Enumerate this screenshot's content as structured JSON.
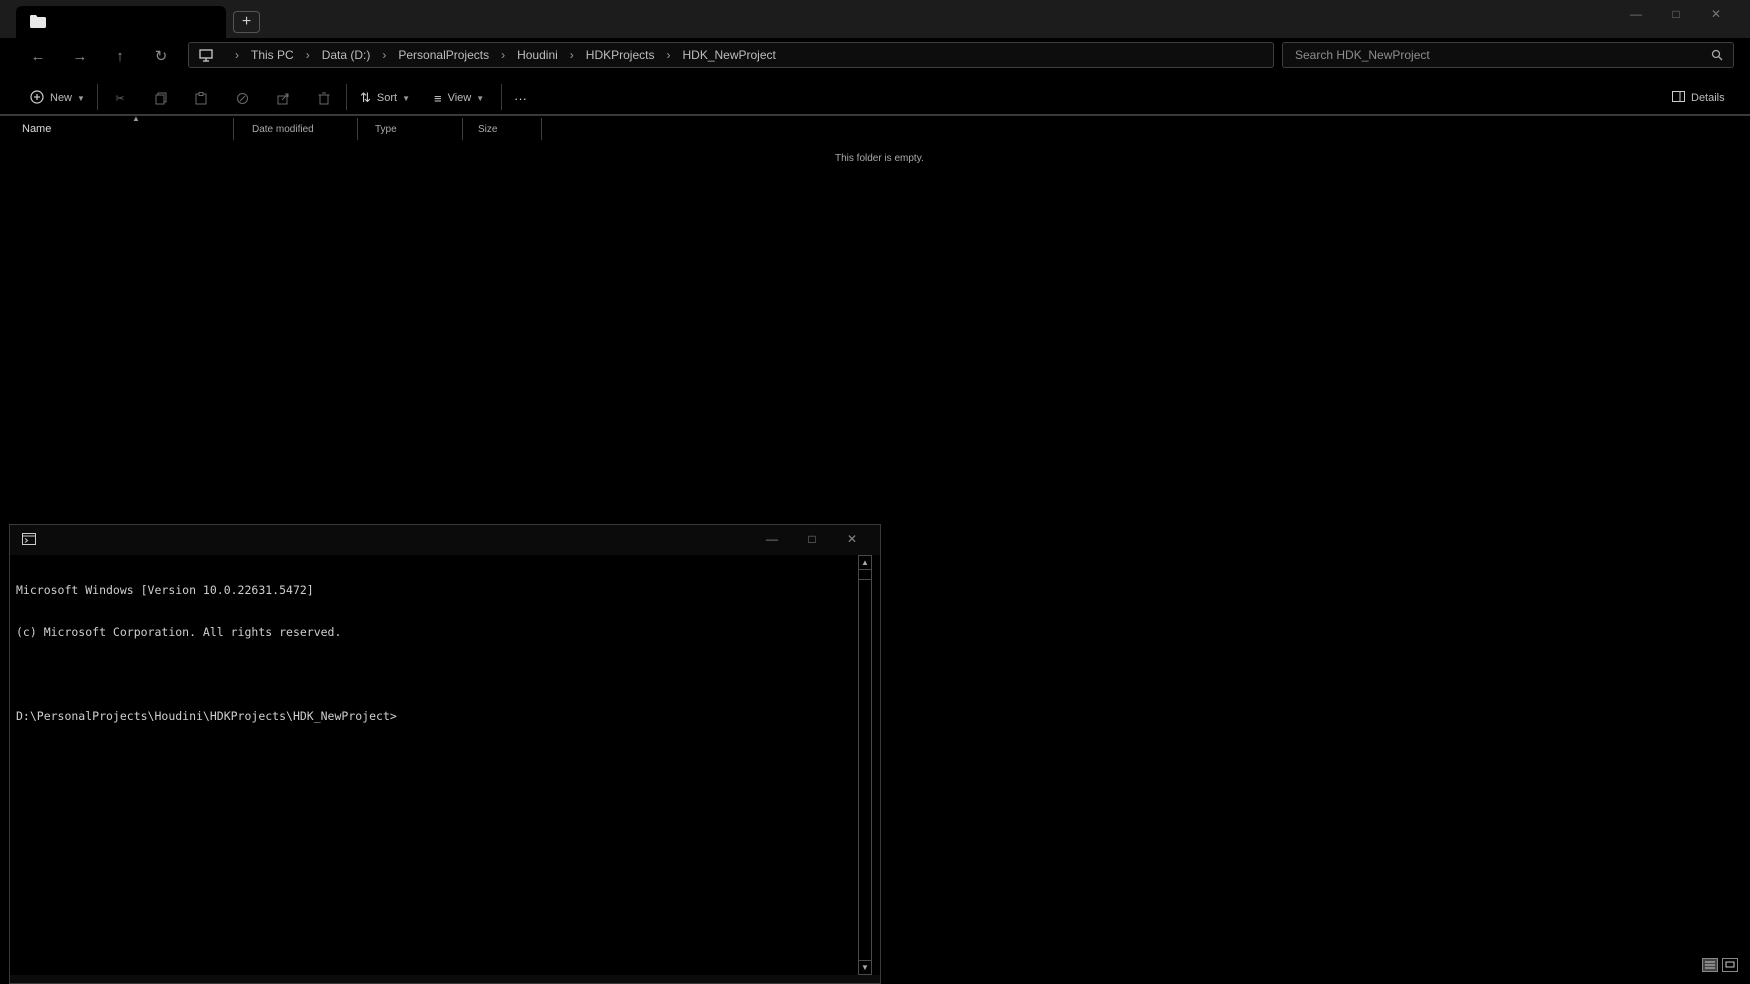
{
  "window": {
    "controls": [
      "minimize",
      "maximize",
      "close"
    ]
  },
  "tabs": {
    "new_tab_label": "+"
  },
  "address": {
    "breadcrumbs": [
      "This PC",
      "Data (D:)",
      "PersonalProjects",
      "Houdini",
      "HDKProjects",
      "HDK_NewProject"
    ]
  },
  "search": {
    "placeholder": "Search HDK_NewProject"
  },
  "commands": {
    "new_label": "New",
    "sort_label": "Sort",
    "view_label": "View",
    "more_label": "···",
    "details_label": "Details"
  },
  "columns": {
    "name": "Name",
    "date_modified": "Date modified",
    "type": "Type",
    "size": "Size"
  },
  "content": {
    "empty_message": "This folder is empty."
  },
  "console": {
    "lines": [
      "Microsoft Windows [Version 10.0.22631.5472]",
      "(c) Microsoft Corporation. All rights reserved.",
      "",
      "D:\\PersonalProjects\\Houdini\\HDKProjects\\HDK_NewProject>"
    ]
  }
}
